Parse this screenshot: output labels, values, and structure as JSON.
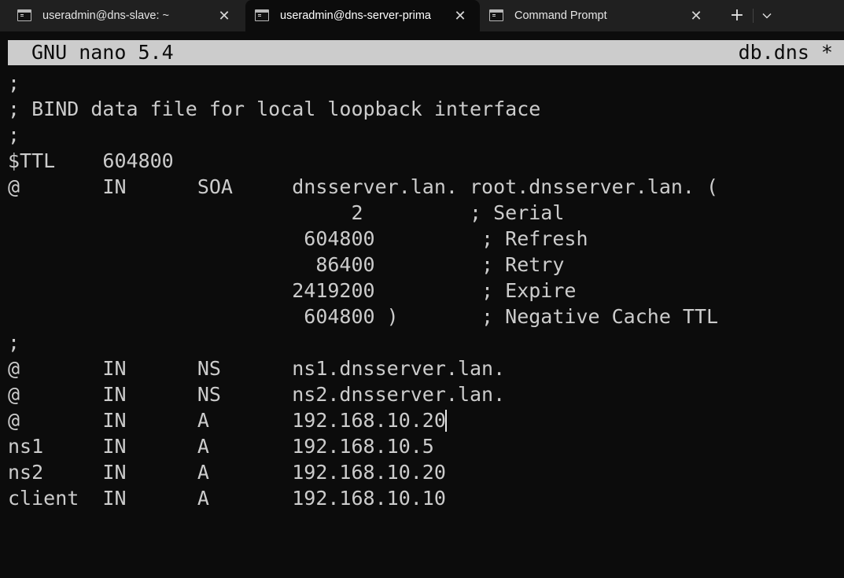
{
  "tabs": [
    {
      "title": "useradmin@dns-slave: ~",
      "active": false,
      "icon": "terminal-icon"
    },
    {
      "title": "useradmin@dns-server-prima",
      "active": true,
      "icon": "terminal-icon"
    },
    {
      "title": "Command Prompt",
      "active": false,
      "icon": "terminal-icon"
    }
  ],
  "tabbar": {
    "close_glyph": "✕",
    "new_tab_glyph": "+",
    "dropdown_icon": "chevron-down-icon"
  },
  "nano": {
    "version": "GNU nano 5.4",
    "filename": "db.dns *"
  },
  "file_lines": [
    ";",
    "; BIND data file for local loopback interface",
    ";",
    "$TTL    604800",
    "@       IN      SOA     dnsserver.lan. root.dnsserver.lan. (",
    "                             2         ; Serial",
    "                         604800         ; Refresh",
    "                          86400         ; Retry",
    "                        2419200         ; Expire",
    "                         604800 )       ; Negative Cache TTL",
    ";",
    "@       IN      NS      ns1.dnsserver.lan.",
    "@       IN      NS      ns2.dnsserver.lan.",
    "@       IN      A       192.168.10.20",
    "ns1     IN      A       192.168.10.5",
    "ns2     IN      A       192.168.10.20",
    "client  IN      A       192.168.10.10"
  ],
  "cursor": {
    "line": 13
  },
  "colors": {
    "terminal_bg": "#0c0c0c",
    "terminal_fg": "#cccccc",
    "tabbar_bg": "#202020",
    "nano_header_bg": "#cccccc"
  }
}
